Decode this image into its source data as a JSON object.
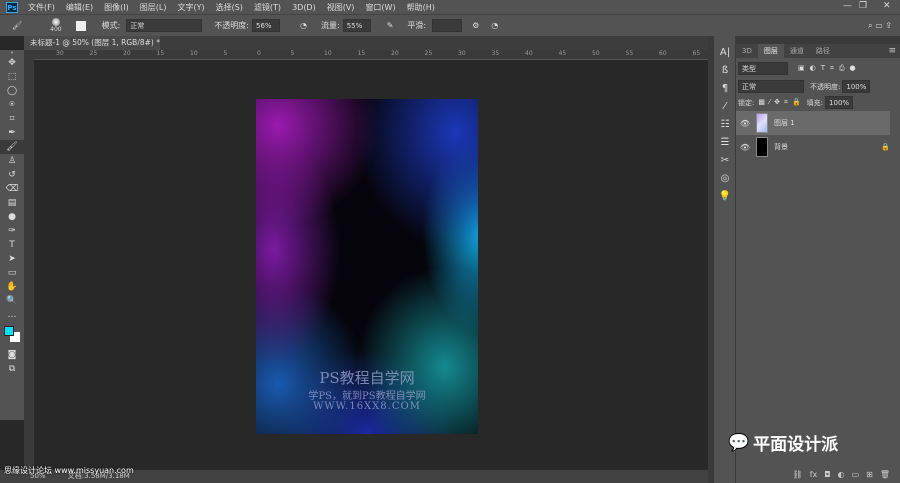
{
  "menu": {
    "app_icon": "Ps",
    "items": [
      "文件(F)",
      "编辑(E)",
      "图像(I)",
      "图层(L)",
      "文字(Y)",
      "选择(S)",
      "滤镜(T)",
      "3D(D)",
      "视图(V)",
      "窗口(W)",
      "帮助(H)"
    ]
  },
  "window_controls": {
    "minimize": "—",
    "restore": "❐",
    "close": "✕"
  },
  "options": {
    "brush_size": "400",
    "mode_label": "模式:",
    "mode_value": "正常",
    "opacity_label": "不透明度:",
    "opacity_value": "56%",
    "flow_label": "流量:",
    "flow_value": "55%",
    "smoothing_label": "平滑:"
  },
  "document": {
    "tab_title": "未标题-1 @ 50% (图层 1, RGB/8#) *",
    "close": "×"
  },
  "ruler_ticks": [
    "30",
    "25",
    "20",
    "15",
    "10",
    "5",
    "0",
    "5",
    "10",
    "15",
    "20",
    "25",
    "30",
    "35",
    "40",
    "45",
    "50",
    "55",
    "60",
    "65"
  ],
  "watermark": {
    "line1": "PS教程自学网",
    "line2": "学PS，就到PS教程自学网",
    "line3": "WWW.16XX8.COM"
  },
  "status": {
    "zoom": "50%",
    "doc": "文档:3.58M/3.18M",
    "overlay": "思缘设计论坛 www.missyuan.com"
  },
  "panel": {
    "tabs": [
      "3D",
      "图层",
      "通道",
      "路径"
    ],
    "filter": "类型",
    "blend_mode": "正常",
    "opacity_label": "不透明度:",
    "opacity_value": "100%",
    "lock_label": "锁定:",
    "fill_label": "填充:",
    "fill_value": "100%",
    "layers": [
      {
        "name": "图层 1",
        "selected": true
      },
      {
        "name": "背景",
        "selected": false
      }
    ]
  },
  "brand": {
    "text": "平面设计派"
  },
  "colors": {
    "foreground": "#00e5ff",
    "background": "#ffffff"
  }
}
